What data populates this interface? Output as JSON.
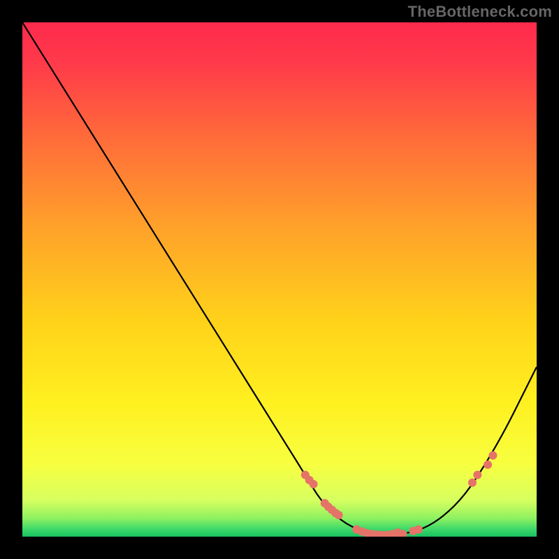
{
  "watermark": "TheBottleneck.com",
  "chart_data": {
    "type": "line",
    "title": "",
    "xlabel": "",
    "ylabel": "",
    "xlim": [
      0,
      100
    ],
    "ylim": [
      0,
      100
    ],
    "series": [
      {
        "name": "curve",
        "x": [
          0,
          5,
          10,
          15,
          20,
          25,
          30,
          35,
          40,
          45,
          50,
          55,
          58,
          62,
          66,
          70,
          74,
          78,
          82,
          86,
          90,
          94,
          97,
          100
        ],
        "values": [
          100,
          92,
          84,
          76,
          68,
          60,
          52,
          44,
          36,
          28,
          20,
          12,
          7,
          3,
          1,
          0.3,
          0.5,
          1.5,
          4,
          8,
          14,
          21,
          27,
          33
        ]
      }
    ],
    "markers": {
      "comment": "salmon dots overlaid on the curve near the valley and on the rising right limb",
      "x": [
        55.0,
        55.8,
        56.6,
        58.8,
        59.5,
        60.2,
        60.9,
        61.5,
        65.0,
        66.0,
        67.0,
        68.0,
        69.0,
        70.0,
        71.0,
        72.0,
        73.0,
        74.0,
        76.0,
        77.0,
        87.5,
        88.5,
        90.5,
        91.5
      ],
      "values": [
        12.0,
        11.0,
        10.2,
        6.5,
        5.8,
        5.2,
        4.6,
        4.2,
        1.4,
        1.0,
        0.7,
        0.5,
        0.4,
        0.3,
        0.35,
        0.5,
        0.8,
        0.5,
        1.1,
        1.4,
        10.5,
        12.0,
        14.0,
        15.8
      ]
    },
    "gradient_stops": [
      {
        "offset": 0.0,
        "color": "#ff2a4d"
      },
      {
        "offset": 0.08,
        "color": "#ff3a4a"
      },
      {
        "offset": 0.22,
        "color": "#ff6a3a"
      },
      {
        "offset": 0.4,
        "color": "#ffa22a"
      },
      {
        "offset": 0.58,
        "color": "#ffd21a"
      },
      {
        "offset": 0.74,
        "color": "#fff020"
      },
      {
        "offset": 0.86,
        "color": "#f7ff40"
      },
      {
        "offset": 0.93,
        "color": "#d6ff60"
      },
      {
        "offset": 0.965,
        "color": "#8cf060"
      },
      {
        "offset": 0.985,
        "color": "#3ed96a"
      },
      {
        "offset": 1.0,
        "color": "#18c060"
      }
    ],
    "colors": {
      "curve": "#000000",
      "marker": "#e57368",
      "background_outside": "#000000"
    }
  }
}
